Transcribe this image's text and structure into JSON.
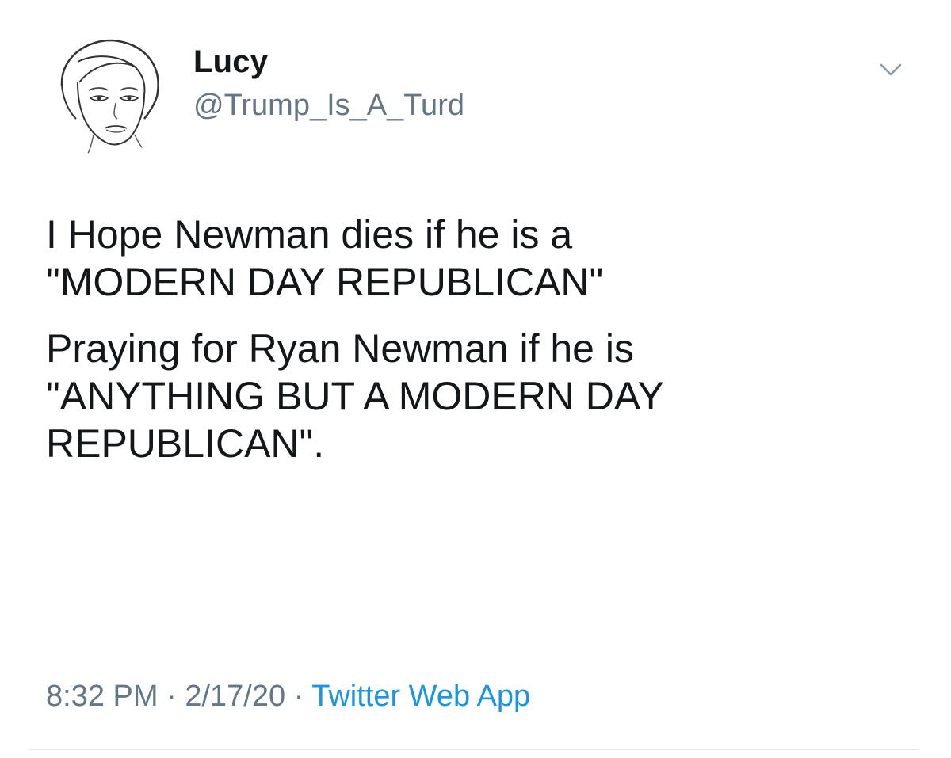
{
  "tweet": {
    "author": {
      "display_name": "Lucy",
      "handle": "@Trump_Is_A_Turd",
      "avatar_icon": "sketched-face-avatar"
    },
    "menu_icon": "chevron-down-icon",
    "paragraphs": [
      "I Hope Newman dies if he is a\n\"MODERN DAY REPUBLICAN\"",
      "Praying for Ryan Newman if he is\n\"ANYTHING BUT A MODERN DAY\nREPUBLICAN\"."
    ],
    "meta": {
      "time": "8:32 PM",
      "separator": "·",
      "date": "2/17/20",
      "source": "Twitter Web App"
    }
  },
  "colors": {
    "text": "#14171a",
    "secondary": "#657786",
    "link": "#1b95e0",
    "divider": "#e1e8ed"
  }
}
